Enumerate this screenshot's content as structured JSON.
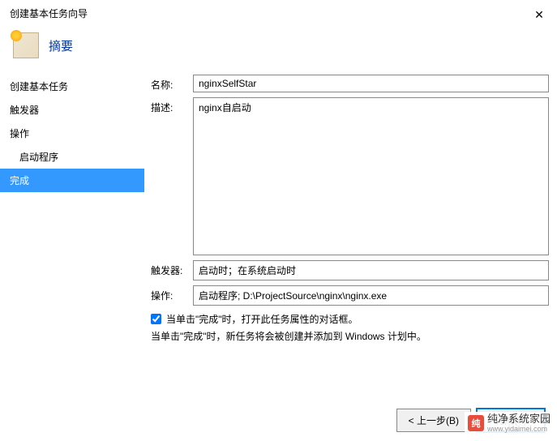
{
  "window": {
    "title": "创建基本任务向导"
  },
  "header": {
    "title": "摘要"
  },
  "sidebar": {
    "items": [
      {
        "label": "创建基本任务"
      },
      {
        "label": "触发器"
      },
      {
        "label": "操作"
      },
      {
        "label": "启动程序"
      },
      {
        "label": "完成"
      }
    ]
  },
  "form": {
    "name_label": "名称:",
    "name_value": "nginxSelfStar",
    "desc_label": "描述:",
    "desc_value": "nginx自启动",
    "trigger_label": "触发器:",
    "trigger_value": "启动时；在系统启动时",
    "action_label": "操作:",
    "action_value": "启动程序; D:\\ProjectSource\\nginx\\nginx.exe"
  },
  "checkbox": {
    "label": "当单击\"完成\"时，打开此任务属性的对话框。"
  },
  "info": {
    "text": "当单击\"完成\"时，新任务将会被创建并添加到 Windows 计划中。"
  },
  "buttons": {
    "back": "< 上一步(B)",
    "finish": "完成(F)"
  },
  "watermark": {
    "brand": "纯净系统家园",
    "url": "www.yidaimei.com"
  }
}
